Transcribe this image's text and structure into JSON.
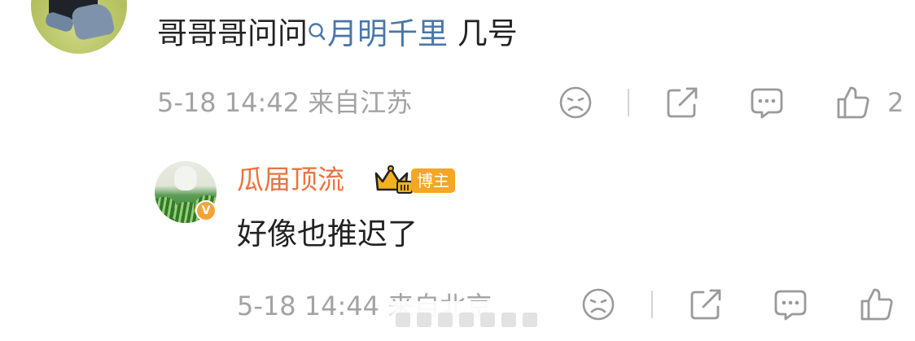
{
  "comment": {
    "text": "哥哥哥问问",
    "mention": "月明千里",
    "text_after": " 几号",
    "date": "5-18 14:42",
    "source": "来自江苏",
    "like_count": "2"
  },
  "reply": {
    "author": "瓜届顶流",
    "badge_label": "博主",
    "verified_mark": "V",
    "text": "好像也推迟了",
    "date": "5-18 14:44",
    "source": "来自北京"
  },
  "icons": [
    "dislike-face-icon",
    "share-icon",
    "comment-icon",
    "like-thumb-icon",
    "search-icon",
    "crown-icon"
  ],
  "colors": {
    "mention": "#4a76a8",
    "author_name": "#eb7340",
    "badge": "#f5a623",
    "meta_text": "#a3a3a3",
    "icon": "#9a9a9a"
  }
}
